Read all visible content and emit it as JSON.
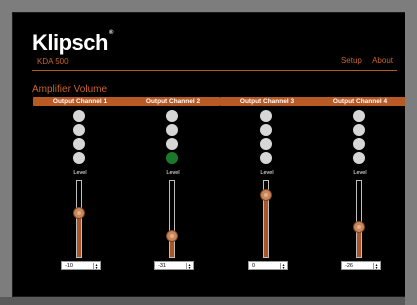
{
  "brand": {
    "name": "Klipsch",
    "reg": "®",
    "model": "KDA 500"
  },
  "nav": {
    "setup": "Setup",
    "about": "About"
  },
  "section_title": "Amplifier Volume",
  "level_label": "Level",
  "channels": [
    {
      "name": "Output Channel 1",
      "value": "-10",
      "level": 0.58,
      "active_led": -1
    },
    {
      "name": "Output Channel 2",
      "value": "-31",
      "level": 0.27,
      "active_led": 3
    },
    {
      "name": "Output Channel 3",
      "value": "0",
      "level": 0.82,
      "active_led": -1
    },
    {
      "name": "Output Channel 4",
      "value": "-26",
      "level": 0.39,
      "active_led": -1
    }
  ],
  "colors": {
    "accent": "#c8642a",
    "led_off": "#d6d6d6",
    "led_on": "#1a7a2a",
    "fill": "#a9552a"
  }
}
